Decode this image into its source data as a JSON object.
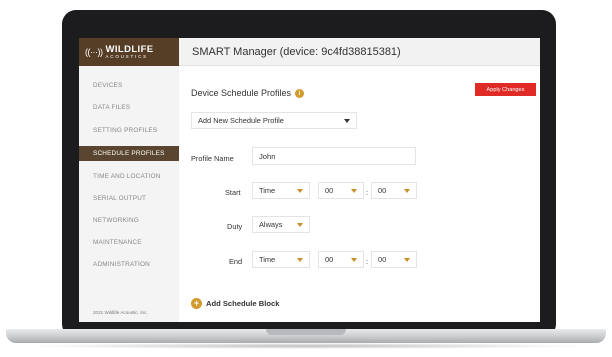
{
  "brand": {
    "mark": "((···))",
    "name": "WILDLIFE",
    "tagline": "ACOUSTICS",
    "color": "#553e25"
  },
  "header": {
    "title": "SMART Manager (device: 9c4fd38815381)"
  },
  "sidebar": {
    "items": [
      {
        "label": "DEVICES"
      },
      {
        "label": "DATA FILES"
      },
      {
        "label": "SETTING PROFILES"
      },
      {
        "label": "SCHEDULE PROFILES"
      },
      {
        "label": "TIME AND LOCATION"
      },
      {
        "label": "SERIAL OUTPUT"
      },
      {
        "label": "NETWORKING"
      },
      {
        "label": "MAINTENANCE"
      },
      {
        "label": "ADMINISTRATION"
      }
    ],
    "active": "SCHEDULE PROFILES",
    "copyright": "2021 Wildlife Acoustic, Inc."
  },
  "main": {
    "section_title": "Device Schedule Profiles",
    "info_icon": "info-icon",
    "apply_button": "Apply Changes",
    "apply_color": "#e02a26",
    "profile_select": "Add New Schedule Profile",
    "profile_name_label": "Profile Name",
    "profile_name_value": "John",
    "start": {
      "label": "Start",
      "mode": "Time",
      "hour": "00",
      "separator": ":",
      "minute": "00"
    },
    "duty": {
      "label": "Duty",
      "value": "Always"
    },
    "end": {
      "label": "End",
      "mode": "Time",
      "hour": "00",
      "separator": ":",
      "minute": "00"
    },
    "add_block_label": "Add Schedule Block",
    "accent_color": "#d39a2e"
  }
}
